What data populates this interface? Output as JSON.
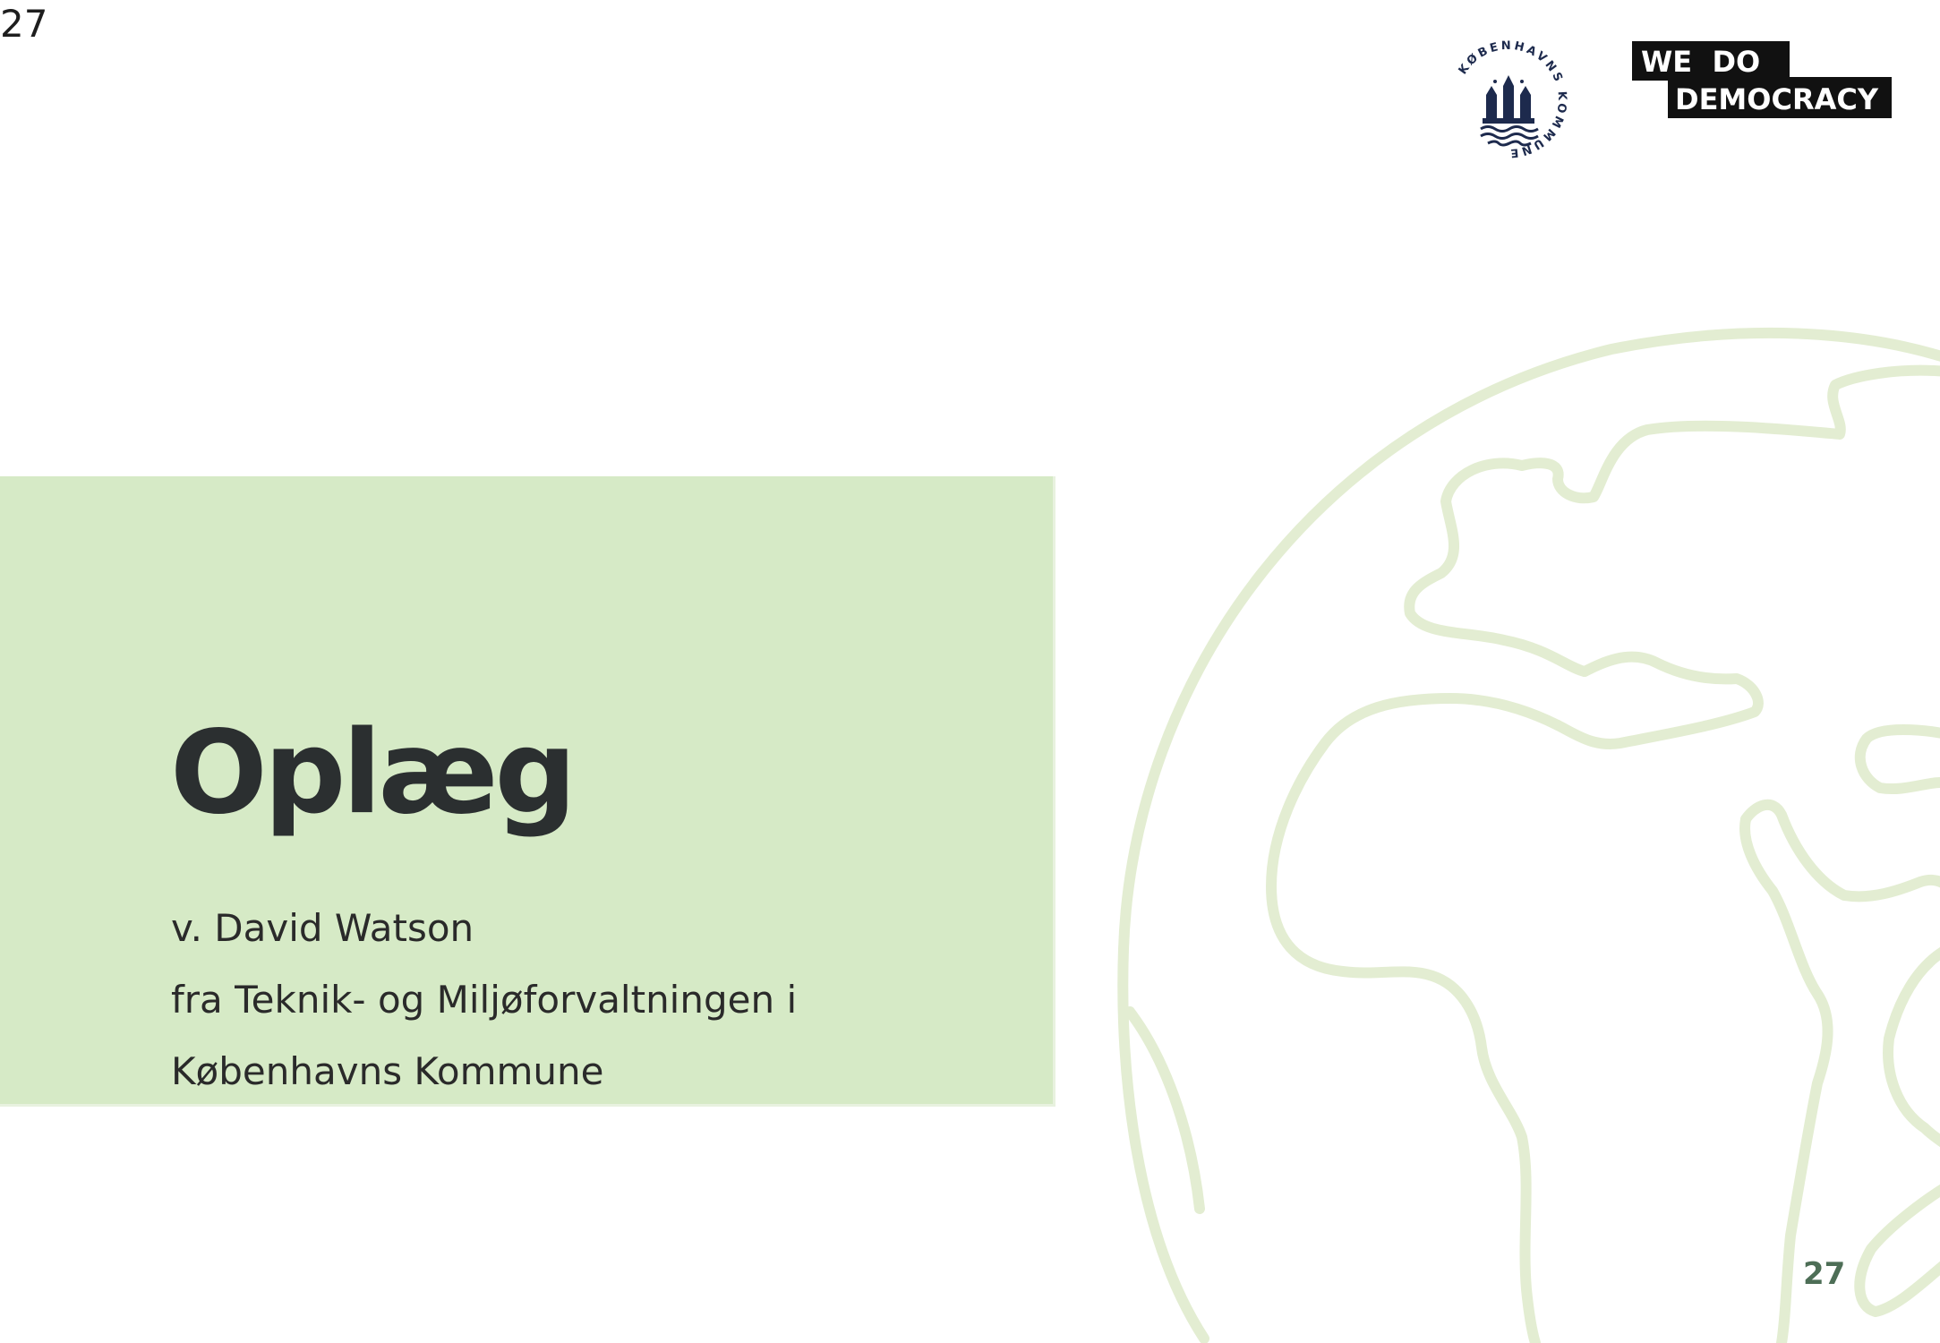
{
  "page_number_top": "27",
  "title": "Oplæg",
  "subtitle_lines": [
    "v. David Watson",
    "fra Teknik- og Miljøforvaltningen i",
    "Københavns Kommune"
  ],
  "logos": {
    "seal_text": "KØBENHAVNS KOMMUNE",
    "wdd_line1": "WE  DO",
    "wdd_line2": "DEMOCRACY"
  },
  "page_number_bottom": "27",
  "colors": {
    "panel": "#d6eac6",
    "globe_line": "#e3edd2",
    "title": "#2b2f30",
    "page_number": "#4d6e56"
  },
  "icons": [
    "globe-outline-illustration",
    "copenhagen-seal-logo",
    "we-do-democracy-logo"
  ]
}
